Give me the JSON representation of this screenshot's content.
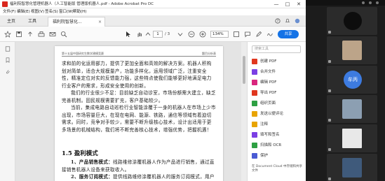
{
  "window": {
    "title": "福利院智慧化管理机器人（人工智能版 管理版机器人.pdf - Adobe Acrobat Pro DC",
    "controls": [
      "—",
      "□",
      "✕"
    ]
  },
  "menu": [
    "文件(F)",
    "编辑(E)",
    "视图(V)",
    "签名(S)",
    "窗口(W)",
    "帮助(H)"
  ],
  "tabs": {
    "home": "主页",
    "tools": "工具",
    "doc": "福利院智慧化..."
  },
  "toolbar": {
    "page_current": "1",
    "page_total": "/ 3",
    "zoom": "134%",
    "share_label": "共享"
  },
  "document": {
    "running_head_left": "第十五届中国研究生数学建模竞赛",
    "running_head_right": "题目分析表",
    "paragraph1": "求和前的化运用部力，提供了更加全面和高效的解决方案。机器人积构划对简单，适合大规模量产，功能多样化，运用领域广泛，注重安全性，精准定位对实的反馈能力强，这些特点使我们能够更好地满足电力行业客户的需求，形成安全使用的创新。",
    "paragraph2": "我们的行业很少不足：目前缺乏自动诊室，市场份额需大建立，缺乏完善机制。固民规模需要扩充，客户基础较少。",
    "paragraph3": "当前，集成电路自动巡检行业智能涂覆于一身的机器人在市场上少市出现，市场容量巨大，在现在电网、能源、铁路，通信等领域有着迫切需求。同时，竞争对手较少，需要不断升级核心技术，设计出适用于更多场景的机械结构，我们将不断完善核心技术，增强优势，把握机遇！",
    "section_heading": "1.5 盈利模式",
    "item1_title": "1、产品销售模式：",
    "item1_text": "线路维修涂覆机器人作为产品进行销售，通过直接销售机器人设备来获取收入。",
    "item2_title": "2、服务订阅模式：",
    "item2_text": "提供线路维修涂覆机器人的服务订阅模式，用户按月订阅机器人的运行服务，根据使用情况支付相应的费用。"
  },
  "right_panel": {
    "search_placeholder": "搜索工具",
    "items": [
      {
        "label": "创建 PDF",
        "icon": "create-pdf-icon",
        "color": "#e0371f"
      },
      {
        "label": "合并文件",
        "icon": "combine-files-icon",
        "color": "#7b3fe4"
      },
      {
        "label": "编辑 PDF",
        "icon": "edit-pdf-icon",
        "color": "#d9267e"
      },
      {
        "label": "导出 PDF",
        "icon": "export-pdf-icon",
        "color": "#e0371f"
      },
      {
        "label": "组织页面",
        "icon": "organize-pages-icon",
        "color": "#2ea043"
      },
      {
        "label": "发送以便评论",
        "icon": "send-comment-icon",
        "color": "#e8a400"
      },
      {
        "label": "注释",
        "icon": "comment-icon",
        "color": "#e8a400"
      },
      {
        "label": "填写和签名",
        "icon": "fill-sign-icon",
        "color": "#7b3fe4"
      },
      {
        "label": "扫描和 OCR",
        "icon": "scan-ocr-icon",
        "color": "#2ea043"
      },
      {
        "label": "保护",
        "icon": "protect-icon",
        "color": "#4a5bd4"
      }
    ],
    "footer": "在 Document Cloud 中存储和共享文件"
  },
  "meeting": {
    "participants": [
      {
        "name": "",
        "avatar": "dark-circle",
        "color": "#0d0d0d"
      },
      {
        "name": "",
        "avatar": "photo",
        "color": "#bca489"
      },
      {
        "name": "",
        "avatar": "initials",
        "initials": "牟丙",
        "color": "#3d7be0"
      },
      {
        "name": "",
        "avatar": "photo",
        "color": "#8c9fb2"
      },
      {
        "name": "",
        "avatar": "light-square",
        "color": "#e8e8e8"
      },
      {
        "name": "",
        "avatar": "photo",
        "color": "#3f5a7b"
      }
    ]
  },
  "colors": {
    "accent": "#1473e6",
    "acrobat_red": "#d9261c"
  }
}
